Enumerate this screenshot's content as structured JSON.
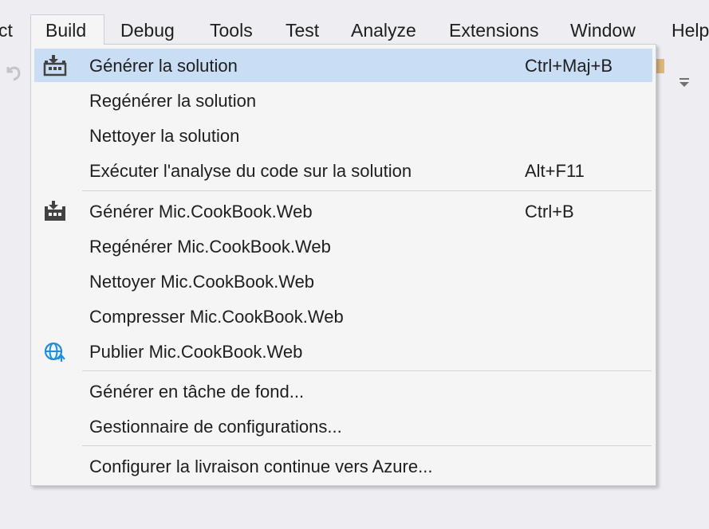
{
  "menubar": {
    "items": [
      {
        "label": "ct"
      },
      {
        "label": "Build"
      },
      {
        "label": "Debug"
      },
      {
        "label": "Tools"
      },
      {
        "label": "Test"
      },
      {
        "label": "Analyze"
      },
      {
        "label": "Extensions"
      },
      {
        "label": "Window"
      },
      {
        "label": "Help"
      }
    ],
    "active": "Build"
  },
  "build_menu": {
    "items": [
      {
        "label": "Générer la solution",
        "shortcut": "Ctrl+Maj+B",
        "icon": "build-solution-icon",
        "highlighted": true
      },
      {
        "label": "Regénérer la solution",
        "shortcut": ""
      },
      {
        "label": "Nettoyer la solution",
        "shortcut": ""
      },
      {
        "label": "Exécuter l'analyse du code sur la solution",
        "shortcut": "Alt+F11"
      },
      {
        "label": "Générer Mic.CookBook.Web",
        "shortcut": "Ctrl+B",
        "icon": "build-project-icon"
      },
      {
        "label": "Regénérer Mic.CookBook.Web",
        "shortcut": ""
      },
      {
        "label": "Nettoyer Mic.CookBook.Web",
        "shortcut": ""
      },
      {
        "label": "Compresser Mic.CookBook.Web",
        "shortcut": ""
      },
      {
        "label": "Publier Mic.CookBook.Web",
        "shortcut": "",
        "icon": "publish-globe-icon"
      },
      {
        "label": "Générer en tâche de fond...",
        "shortcut": ""
      },
      {
        "label": "Gestionnaire de configurations...",
        "shortcut": ""
      },
      {
        "label": "Configurer la livraison continue vers Azure...",
        "shortcut": ""
      }
    ]
  },
  "colors": {
    "highlight": "#c9def5",
    "menu_background": "#f5f5f5",
    "window_background": "#eeeef2",
    "publish_icon": "#1e8fd8"
  }
}
